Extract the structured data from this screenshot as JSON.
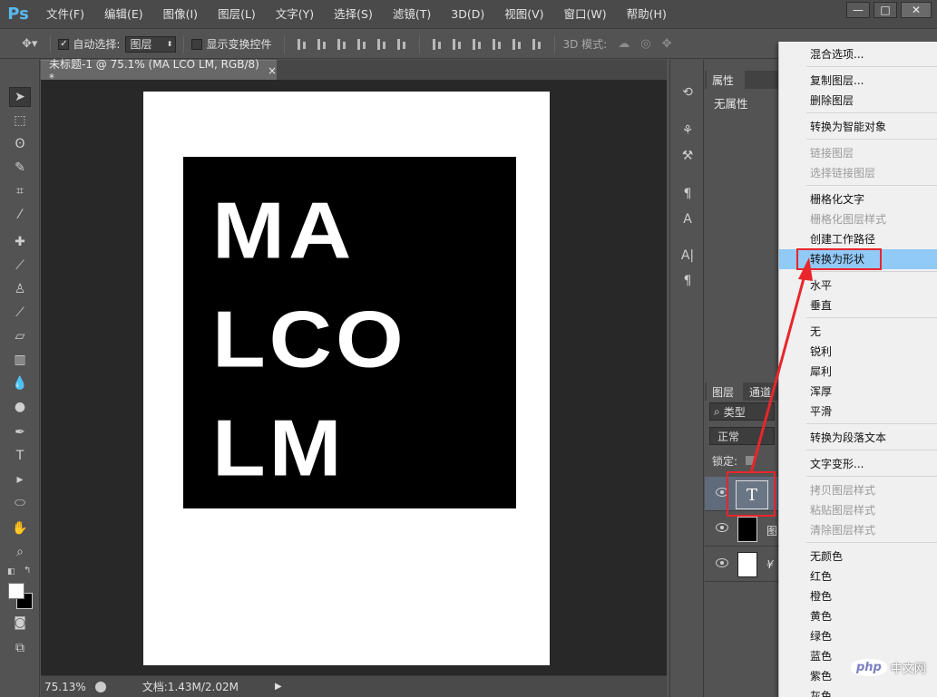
{
  "app": {
    "logo": "Ps"
  },
  "menubar": {
    "items": [
      "文件(F)",
      "编辑(E)",
      "图像(I)",
      "图层(L)",
      "文字(Y)",
      "选择(S)",
      "滤镜(T)",
      "3D(D)",
      "视图(V)",
      "窗口(W)",
      "帮助(H)"
    ]
  },
  "window_buttons": {
    "minimize": "—",
    "restore": "□",
    "close": "✕"
  },
  "options": {
    "auto_select_label": "自动选择:",
    "auto_select_value": "图层",
    "show_transform_label": "显示变换控件",
    "mode_3d_label": "3D 模式:"
  },
  "document": {
    "tab_title": "未标题-1 @ 75.1% (MA LCO LM, RGB/8) *",
    "tab_close": "×",
    "canvas_lines": [
      "MA",
      "LCO",
      "LM"
    ]
  },
  "status": {
    "zoom": "75.13%",
    "doc_info": "文档:1.43M/2.02M"
  },
  "properties": {
    "tab": "属性",
    "empty": "无属性"
  },
  "layers": {
    "tab_layers": "图层",
    "tab_channels": "通道",
    "filter_label": "类型",
    "blend_mode": "正常",
    "lock_label": "锁定:",
    "rows": [
      {
        "label": "T",
        "name_fragment": ""
      },
      {
        "label": "",
        "name_fragment": "图"
      },
      {
        "label": "",
        "name_fragment": "¥"
      }
    ]
  },
  "context_menu": {
    "items": [
      {
        "label": "混合选项...",
        "disabled": false
      },
      {
        "label": "复制图层...",
        "disabled": false
      },
      {
        "label": "删除图层",
        "disabled": false
      },
      {
        "label": "转换为智能对象",
        "disabled": false
      },
      {
        "label": "链接图层",
        "disabled": true
      },
      {
        "label": "选择链接图层",
        "disabled": true
      },
      {
        "label": "栅格化文字",
        "disabled": false
      },
      {
        "label": "栅格化图层样式",
        "disabled": true
      },
      {
        "label": "创建工作路径",
        "disabled": false
      },
      {
        "label": "转换为形状",
        "disabled": false,
        "highlighted": true
      },
      {
        "label": "水平",
        "disabled": false
      },
      {
        "label": "垂直",
        "disabled": false
      },
      {
        "label": "无",
        "disabled": false
      },
      {
        "label": "锐利",
        "disabled": false
      },
      {
        "label": "犀利",
        "disabled": false
      },
      {
        "label": "浑厚",
        "disabled": false
      },
      {
        "label": "平滑",
        "disabled": false
      },
      {
        "label": "转换为段落文本",
        "disabled": false
      },
      {
        "label": "文字变形...",
        "disabled": false
      },
      {
        "label": "拷贝图层样式",
        "disabled": true
      },
      {
        "label": "粘贴图层样式",
        "disabled": true
      },
      {
        "label": "清除图层样式",
        "disabled": true
      },
      {
        "label": "无颜色",
        "disabled": false
      },
      {
        "label": "红色",
        "disabled": false
      },
      {
        "label": "橙色",
        "disabled": false
      },
      {
        "label": "黄色",
        "disabled": false
      },
      {
        "label": "绿色",
        "disabled": false
      },
      {
        "label": "蓝色",
        "disabled": false
      },
      {
        "label": "紫色",
        "disabled": false
      },
      {
        "label": "灰色",
        "disabled": false
      }
    ]
  },
  "watermark": {
    "badge": "php",
    "text": "中文网"
  },
  "colors": {
    "annotation_red": "#e8262b",
    "menu_highlight": "#91c9f7",
    "ps_blue": "#59b8f0"
  }
}
